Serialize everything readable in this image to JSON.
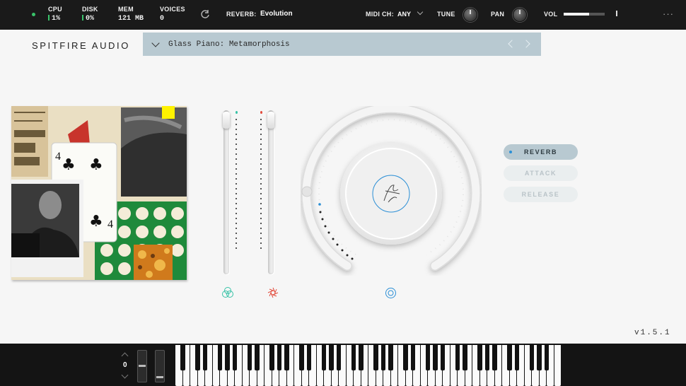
{
  "topbar": {
    "cpu": {
      "label": "CPU",
      "value": "1%"
    },
    "disk": {
      "label": "DISK",
      "value": "0%"
    },
    "mem": {
      "label": "MEM",
      "value": "121 MB"
    },
    "voices": {
      "label": "VOICES",
      "value": "0"
    },
    "reverb_label": "REVERB:",
    "reverb_value": "Evolution",
    "midi_label": "MIDI CH:",
    "midi_value": "ANY",
    "tune_label": "TUNE",
    "pan_label": "PAN",
    "vol_label": "VOL",
    "volume_level": 0.62
  },
  "header": {
    "brand": "SPITFIRE AUDIO",
    "preset": "Glass Piano: Metamorphosis"
  },
  "buttons": {
    "reverb": "REVERB",
    "attack": "ATTACK",
    "release": "RELEASE"
  },
  "version": "v1.5.1",
  "keyboard": {
    "octave_value": "0"
  },
  "colors": {
    "accent": "#2b8fd6",
    "teal": "#36c2a6",
    "red": "#e24a3b",
    "preset_bar": "#b8c9d1"
  }
}
